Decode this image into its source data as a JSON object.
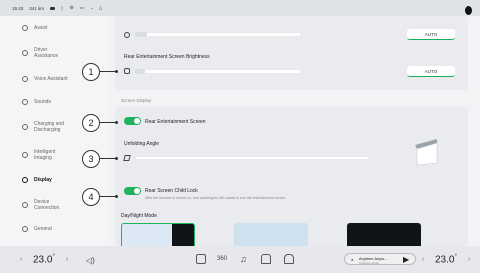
{
  "status_bar": {
    "time": "15:43",
    "range": "341 km",
    "icons": [
      "battery-icon",
      "bluetooth-icon",
      "gear-icon",
      "signal-icon",
      "wifi-icon",
      "bell-icon"
    ]
  },
  "sidebar": {
    "items": [
      {
        "label": "Assist",
        "icon": "assist-icon"
      },
      {
        "label": "Driver Assistance",
        "icon": "steering-icon"
      },
      {
        "label": "Voice Assistant",
        "icon": "microphone-icon"
      },
      {
        "label": "Sounds",
        "icon": "speaker-icon"
      },
      {
        "label": "Charging and Discharging",
        "icon": "charging-icon"
      },
      {
        "label": "Intelligent Imaging",
        "icon": "camera-icon"
      },
      {
        "label": "Display",
        "icon": "sun-icon",
        "active": true
      },
      {
        "label": "Device Connection",
        "icon": "device-icon"
      },
      {
        "label": "General",
        "icon": "settings-icon"
      }
    ]
  },
  "main": {
    "brightness_auto_label": "AUTO",
    "rear_brightness_title": "Rear Entertainment Screen Brightness",
    "rear_brightness_auto_label": "AUTO",
    "screen_display_heading": "Screen Display",
    "rear_screen_label": "Rear Entertainment Screen",
    "rear_screen_on": true,
    "unfolding_angle_title": "Unfolding Angle",
    "child_lock_label": "Rear Screen Child Lock",
    "child_lock_on": true,
    "child_lock_desc": "After the function is turned on, rear passengers will unable to use the entertainment screen",
    "day_night_title": "Day/Night Mode",
    "day_night_options": [
      "light",
      "mixed",
      "dark"
    ]
  },
  "callouts": [
    "1",
    "2",
    "3",
    "4"
  ],
  "bottom_bar": {
    "left_temp": "23.0",
    "right_temp": "23.0",
    "temp_unit": "°",
    "media_title": "Anytime Anyw...",
    "media_sub": "Unknown Artist",
    "dock_icons": [
      "grid-icon",
      "360-icon",
      "music-icon",
      "car-icon",
      "home-icon"
    ]
  },
  "colors": {
    "accent_green": "#1fb35e",
    "sidebar_bg": "#f4f5f7",
    "panel_bg": "#f2f3f5",
    "card_bg": "#e9ebef"
  }
}
